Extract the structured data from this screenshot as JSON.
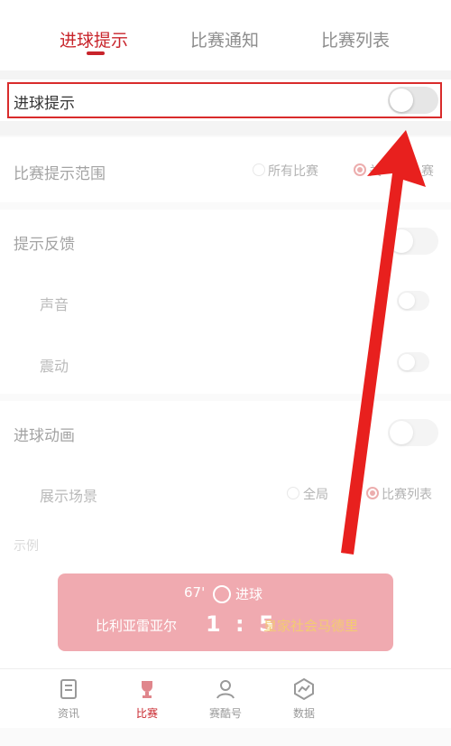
{
  "tabs": [
    {
      "label": "进球提示",
      "active": true
    },
    {
      "label": "比赛通知",
      "active": false
    },
    {
      "label": "比赛列表",
      "active": false
    }
  ],
  "settings": {
    "goal_alert": {
      "label": "进球提示",
      "on": false
    },
    "match_range": {
      "label": "比赛提示范围",
      "options": [
        "所有比赛",
        "关注的比赛"
      ],
      "option_visible": "关",
      "option_tail": "赛",
      "selected": "关注的比赛"
    },
    "feedback": {
      "label": "提示反馈",
      "on": false
    },
    "sound": {
      "label": "声音",
      "on": false
    },
    "vibration": {
      "label": "震动",
      "on": false
    },
    "goal_animation": {
      "label": "进球动画",
      "on": false
    },
    "display_scene": {
      "label": "展示场景",
      "options": [
        "全局",
        "比赛列表"
      ],
      "selected": "比赛列表"
    },
    "example_label": "示例"
  },
  "toast": {
    "minute": "67'",
    "event": "进球",
    "home": "比利亚雷亚尔",
    "score": "1 : 5",
    "away": "皇家社会马德里"
  },
  "bottom_nav": [
    {
      "label": "资讯",
      "icon": "news-icon",
      "active": false
    },
    {
      "label": "比赛",
      "icon": "trophy-icon",
      "active": true
    },
    {
      "label": "赛酷号",
      "icon": "person-icon",
      "active": false
    },
    {
      "label": "数据",
      "icon": "chart-icon",
      "active": false
    }
  ],
  "colors": {
    "accent": "#c8242b",
    "highlight_border": "#d92b2b",
    "arrow": "#e8201e"
  }
}
